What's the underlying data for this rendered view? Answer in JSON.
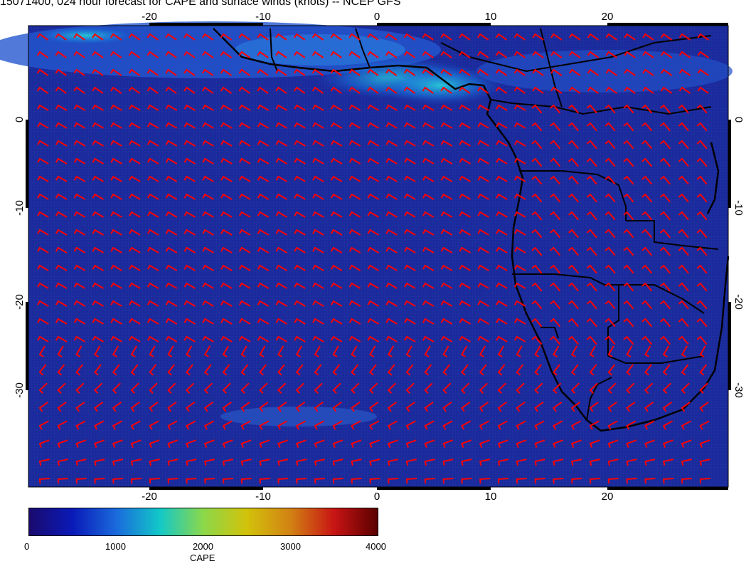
{
  "title": "15071400, 024 hour forecast for CAPE and surface winds (knots) -- NCEP GFS",
  "map": {
    "lon_range": [
      -30,
      30
    ],
    "lat_range": [
      -40,
      10
    ],
    "lon_ticks": [
      "-20",
      "-10",
      "0",
      "10",
      "20"
    ],
    "lat_ticks": [
      "0",
      "-10",
      "-20",
      "-30"
    ],
    "background_color": "#1a2a9c",
    "wind_barb_color": "#ff0000",
    "coastline_color": "#000000"
  },
  "colorbar": {
    "label": "CAPE",
    "ticks": [
      "0",
      "1000",
      "2000",
      "3000",
      "4000"
    ],
    "range": [
      0,
      4000
    ],
    "colors": [
      "#1a0a6e",
      "#0a1ab8",
      "#1a6adc",
      "#12c8c8",
      "#8cd84a",
      "#d2c20a",
      "#d28214",
      "#c81414",
      "#5a0000"
    ]
  }
}
